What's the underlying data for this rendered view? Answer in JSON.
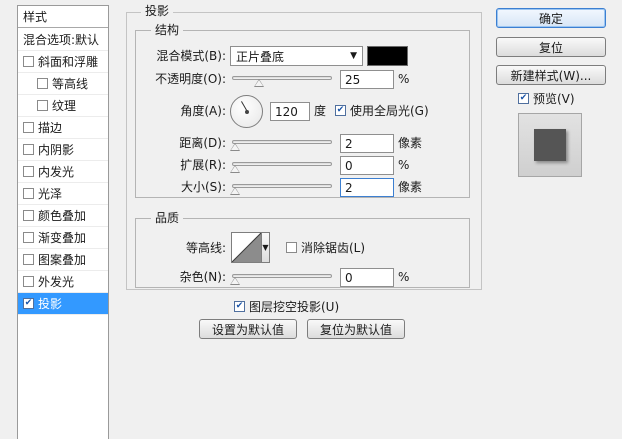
{
  "sidebar": {
    "header": "样式",
    "items": [
      {
        "label": "混合选项:默认",
        "checkbox": false,
        "checked": false,
        "selected": false
      },
      {
        "label": "斜面和浮雕",
        "checkbox": true,
        "checked": false,
        "selected": false
      },
      {
        "label": "等高线",
        "checkbox": true,
        "checked": false,
        "selected": false
      },
      {
        "label": "纹理",
        "checkbox": true,
        "checked": false,
        "selected": false
      },
      {
        "label": "描边",
        "checkbox": true,
        "checked": false,
        "selected": false
      },
      {
        "label": "内阴影",
        "checkbox": true,
        "checked": false,
        "selected": false
      },
      {
        "label": "内发光",
        "checkbox": true,
        "checked": false,
        "selected": false
      },
      {
        "label": "光泽",
        "checkbox": true,
        "checked": false,
        "selected": false
      },
      {
        "label": "颜色叠加",
        "checkbox": true,
        "checked": false,
        "selected": false
      },
      {
        "label": "渐变叠加",
        "checkbox": true,
        "checked": false,
        "selected": false
      },
      {
        "label": "图案叠加",
        "checkbox": true,
        "checked": false,
        "selected": false
      },
      {
        "label": "外发光",
        "checkbox": true,
        "checked": false,
        "selected": false
      },
      {
        "label": "投影",
        "checkbox": true,
        "checked": true,
        "selected": true
      }
    ]
  },
  "panel": {
    "title": "投影",
    "structure": {
      "title": "结构",
      "blend_mode_label": "混合模式(B):",
      "blend_mode_value": "正片叠底",
      "shadow_color": "#000000",
      "opacity_label": "不透明度(O):",
      "opacity_value": "25",
      "opacity_percent": 25,
      "opacity_unit": "%",
      "angle_label": "角度(A):",
      "angle_value": "120",
      "angle_unit": "度",
      "global_light_label": "使用全局光(G)",
      "global_light_checked": true,
      "distance_label": "距离(D):",
      "distance_value": "2",
      "distance_unit": "像素",
      "spread_label": "扩展(R):",
      "spread_value": "0",
      "spread_unit": "%",
      "size_label": "大小(S):",
      "size_value": "2",
      "size_unit": "像素"
    },
    "quality": {
      "title": "品质",
      "contour_label": "等高线:",
      "anti_alias_label": "消除锯齿(L)",
      "anti_alias_checked": false,
      "noise_label": "杂色(N):",
      "noise_value": "0",
      "noise_unit": "%"
    },
    "knockout_label": "图层挖空投影(U)",
    "knockout_checked": true,
    "make_default_label": "设置为默认值",
    "reset_default_label": "复位为默认值"
  },
  "actions": {
    "ok_label": "确定",
    "reset_label": "复位",
    "new_style_label": "新建样式(W)...",
    "preview_label": "预览(V)",
    "preview_checked": true
  },
  "icons": {
    "checkbox_check": "check-icon",
    "dropdown": "chevron-down-icon",
    "slider_thumb": "triangle-up-icon",
    "angle": "angle-dial-icon",
    "contour": "contour-curve-icon"
  }
}
